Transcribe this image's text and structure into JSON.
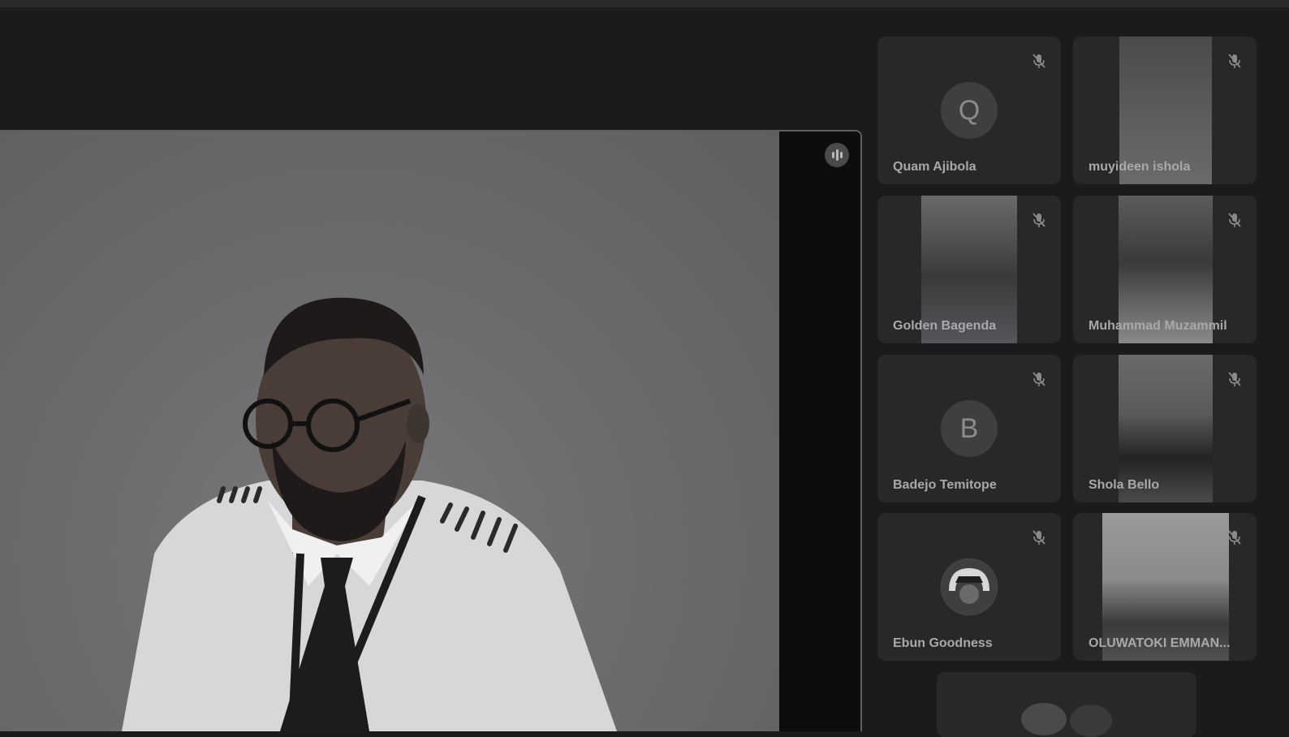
{
  "stage": {
    "speaker_label": "",
    "speaking_indicator_icon": "audio-levels-icon"
  },
  "participants": [
    {
      "name": "Quam Ajibola",
      "type": "avatar",
      "initial": "Q"
    },
    {
      "name": "muyideen ishola",
      "type": "video"
    },
    {
      "name": "Golden Bagenda",
      "type": "video"
    },
    {
      "name": "Muhammad Muzammil",
      "type": "video"
    },
    {
      "name": "Badejo Temitope",
      "type": "avatar",
      "initial": "B"
    },
    {
      "name": "Shola Bello",
      "type": "video"
    },
    {
      "name": "Ebun Goodness",
      "type": "image-avatar"
    },
    {
      "name": "OLUWATOKI EMMAN...",
      "type": "video"
    }
  ],
  "icons": {
    "mic": "mic-off-icon"
  },
  "colors": {
    "background": "#1b1b1d",
    "tile": "#28282b",
    "text": "#a9a9ac"
  }
}
